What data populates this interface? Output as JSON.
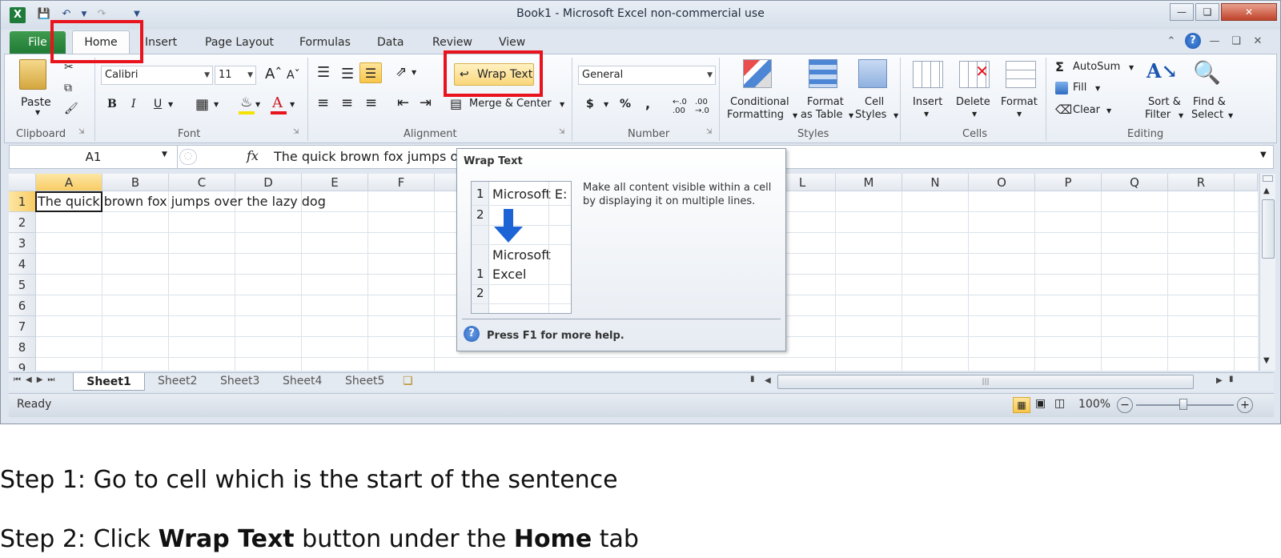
{
  "window": {
    "title": "Book1  -  Microsoft Excel non-commercial use",
    "app_icon_letter": "X"
  },
  "tabs": {
    "file": "File",
    "home": "Home",
    "insert": "Insert",
    "page_layout": "Page Layout",
    "formulas": "Formulas",
    "data": "Data",
    "review": "Review",
    "view": "View"
  },
  "ribbon": {
    "clipboard": {
      "paste": "Paste",
      "group": "Clipboard"
    },
    "font": {
      "name": "Calibri",
      "size": "11",
      "group": "Font",
      "bold": "B",
      "italic": "I",
      "underline": "U",
      "font_color": "A"
    },
    "alignment": {
      "wrap_text": "Wrap Text",
      "merge_center": "Merge & Center",
      "group": "Alignment"
    },
    "number": {
      "format": "General",
      "currency": "$",
      "percent": "%",
      "comma": ",",
      "group": "Number"
    },
    "styles": {
      "conditional": "Conditional",
      "conditional2": "Formatting",
      "format_table": "Format",
      "format_table2": "as Table",
      "cell_styles": "Cell",
      "cell_styles2": "Styles",
      "group": "Styles"
    },
    "cells": {
      "insert": "Insert",
      "delete": "Delete",
      "format": "Format",
      "group": "Cells"
    },
    "editing": {
      "autosum": "AutoSum",
      "fill": "Fill",
      "clear": "Clear",
      "sort": "Sort &",
      "sort2": "Filter",
      "find": "Find &",
      "find2": "Select",
      "group": "Editing",
      "sigma": "Σ"
    }
  },
  "formula_bar": {
    "name_box": "A1",
    "fx": "fx",
    "content": "The quick brown fox jumps o"
  },
  "grid": {
    "columns": [
      "A",
      "B",
      "C",
      "D",
      "E",
      "F",
      "L",
      "M",
      "N",
      "O",
      "P",
      "Q",
      "R"
    ],
    "rows": [
      "1",
      "2",
      "3",
      "4",
      "5",
      "6",
      "7",
      "8",
      "9"
    ],
    "cell_a1": "The quick brown fox jumps over the lazy dog"
  },
  "sheets": [
    "Sheet1",
    "Sheet2",
    "Sheet3",
    "Sheet4",
    "Sheet5"
  ],
  "status": {
    "ready": "Ready",
    "zoom": "100%"
  },
  "tooltip": {
    "title": "Wrap Text",
    "description": "Make all content visible within a cell by displaying it on multiple lines.",
    "help": "Press F1 for more help.",
    "demo_before": "Microsoft E:",
    "demo_after_1": "Microsoft",
    "demo_after_2": "Excel",
    "demo_row1": "1",
    "demo_row2": "2"
  },
  "steps": {
    "step1": "Step 1: Go to cell which is the start of the sentence",
    "step2_prefix": "Step 2: Click ",
    "step2_bold1": "Wrap Text",
    "step2_mid": " button under the ",
    "step2_bold2": "Home",
    "step2_suffix": " tab"
  },
  "colors": {
    "highlight": "#e8131c",
    "file_tab": "#207a35",
    "selected_header": "#f8cc64"
  }
}
